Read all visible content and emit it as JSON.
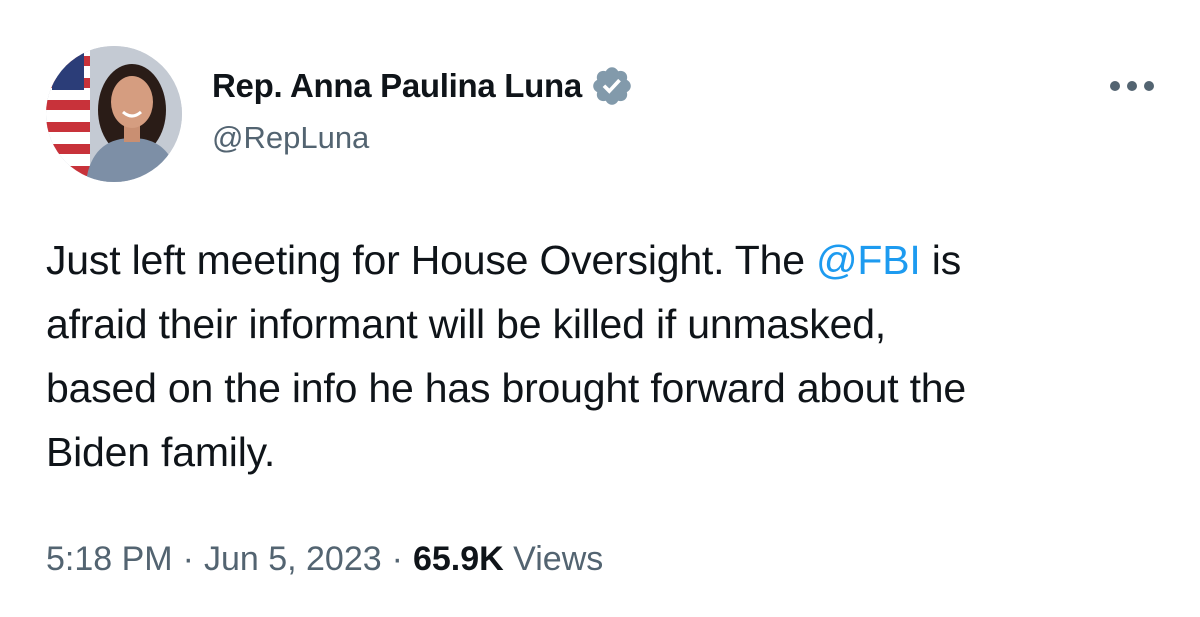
{
  "author": {
    "display_name": "Rep. Anna Paulina Luna",
    "handle": "@RepLuna",
    "verified_icon": "verified-badge-icon",
    "verified_color": "#829aab"
  },
  "more_icon": "more-options-icon",
  "tweet": {
    "text_lines": [
      {
        "before": "Just left meeting for House Oversight. The ",
        "mention": "@FBI",
        "after": " is"
      },
      {
        "text": "afraid their informant will be killed if unmasked,"
      },
      {
        "text": "based on the info he has brought forward about the"
      },
      {
        "text": "Biden family."
      }
    ]
  },
  "meta": {
    "time": "5:18 PM",
    "separator": "·",
    "date": "Jun 5, 2023",
    "views_count": "65.9K",
    "views_label": "Views"
  },
  "colors": {
    "text": "#0f1419",
    "secondary": "#536471",
    "link": "#1d9bf0"
  }
}
